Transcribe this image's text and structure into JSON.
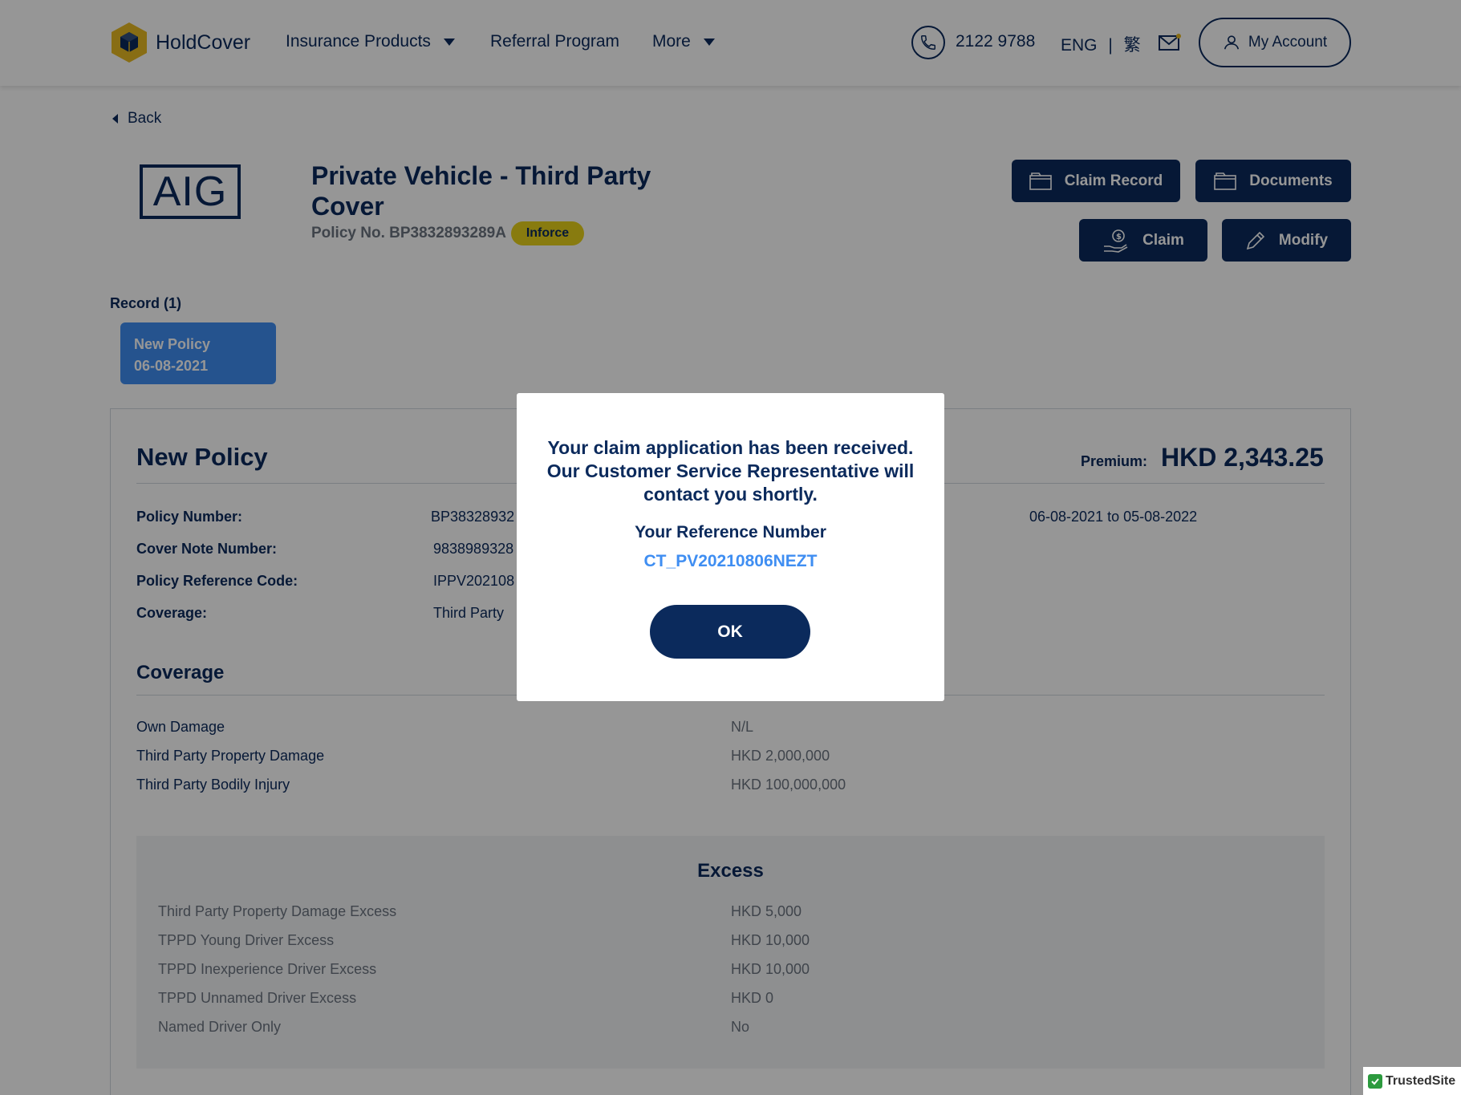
{
  "brand": {
    "name": "HoldCover",
    "accent": "#0b2a5c",
    "logo_color": "#e8b923"
  },
  "nav": {
    "items": [
      {
        "label": "Insurance Products",
        "has_dropdown": true
      },
      {
        "label": "Referral Program",
        "has_dropdown": false
      },
      {
        "label": "More",
        "has_dropdown": true
      }
    ],
    "phone": "2122 9788",
    "lang_en": "ENG",
    "lang_sep": "|",
    "lang_zh": "繁",
    "account_label": "My Account"
  },
  "back_label": "Back",
  "policy": {
    "insurer_logo": "AIG",
    "title": "Private Vehicle - Third Party Cover",
    "number_line": "Policy No. BP3832893289A",
    "status": "Inforce",
    "status_color": "#e8d21a"
  },
  "actions": {
    "claim_record": "Claim Record",
    "documents": "Documents",
    "claim": "Claim",
    "modify": "Modify"
  },
  "records": {
    "label": "Record (1)",
    "items": [
      {
        "type": "New Policy",
        "date": "06-08-2021"
      }
    ]
  },
  "details": {
    "title": "New Policy",
    "premium_label": "Premium:",
    "premium_value": "HKD 2,343.25",
    "rows": [
      {
        "label": "Policy Number:",
        "value": "BP38328932"
      },
      {
        "label": "Cover Note Number:",
        "value": "9838989328"
      },
      {
        "label": "Policy Reference Code:",
        "value": "IPPV202108"
      },
      {
        "label": "Coverage:",
        "value": "Third Party"
      }
    ],
    "period": "06-08-2021 to 05-08-2022"
  },
  "coverage": {
    "title": "Coverage",
    "rows": [
      {
        "label": "Own Damage",
        "value": "N/L"
      },
      {
        "label": "Third Party Property Damage",
        "value": "HKD 2,000,000"
      },
      {
        "label": "Third Party Bodily Injury",
        "value": "HKD 100,000,000"
      }
    ]
  },
  "excess": {
    "title": "Excess",
    "rows": [
      {
        "label": "Third Party Property Damage Excess",
        "value": "HKD 5,000"
      },
      {
        "label": "TPPD Young Driver Excess",
        "value": "HKD 10,000"
      },
      {
        "label": "TPPD Inexperience Driver Excess",
        "value": "HKD 10,000"
      },
      {
        "label": "TPPD Unnamed Driver Excess",
        "value": "HKD 0"
      },
      {
        "label": "Named Driver Only",
        "value": "No"
      }
    ]
  },
  "modal": {
    "message": "Your claim application has been received. Our Customer Service Representative will contact you shortly.",
    "ref_label": "Your Reference Number",
    "ref_value": "CT_PV20210806NEZT",
    "ok_label": "OK",
    "ref_color": "#3f8ef2"
  },
  "trusted_site": "TrustedSite"
}
